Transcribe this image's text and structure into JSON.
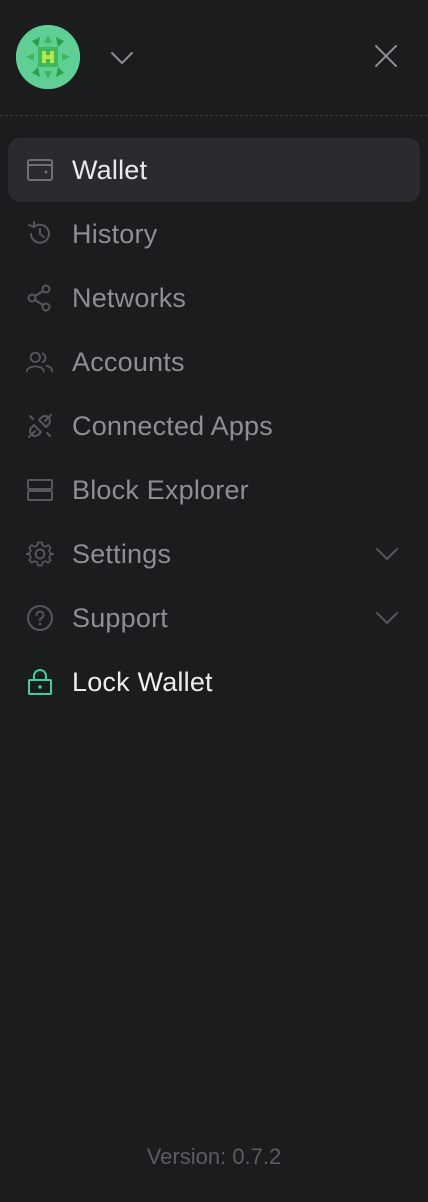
{
  "header": {
    "avatar_icon": "account-identicon",
    "dropdown_icon": "chevron-down-icon",
    "close_icon": "close-icon"
  },
  "nav": {
    "items": [
      {
        "label": "Wallet",
        "icon": "wallet-icon",
        "active": true
      },
      {
        "label": "History",
        "icon": "history-icon"
      },
      {
        "label": "Networks",
        "icon": "share-nodes-icon"
      },
      {
        "label": "Accounts",
        "icon": "users-icon"
      },
      {
        "label": "Connected Apps",
        "icon": "plug-disconnect-icon"
      },
      {
        "label": "Block Explorer",
        "icon": "server-icon"
      },
      {
        "label": "Settings",
        "icon": "gear-icon",
        "expandable": true
      },
      {
        "label": "Support",
        "icon": "question-circle-icon",
        "expandable": true
      },
      {
        "label": "Lock Wallet",
        "icon": "lock-icon"
      }
    ]
  },
  "footer": {
    "version": "Version: 0.7.2"
  },
  "colors": {
    "background": "#1b1c1e",
    "active_item": "#2a2b2e",
    "muted_text": "#8e8f93",
    "accent": "#3ecf9b",
    "avatar": "#5fcf95"
  }
}
